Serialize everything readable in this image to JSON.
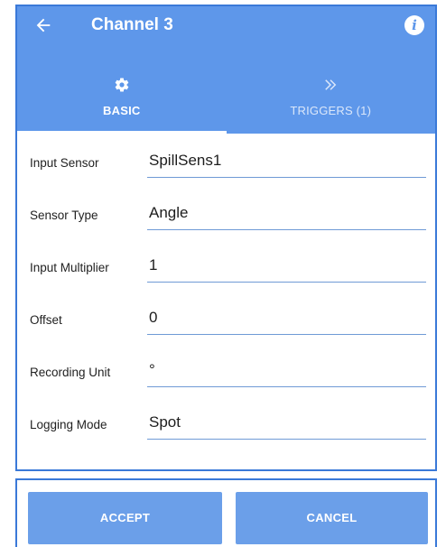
{
  "toolbar": {
    "title": "Channel 3",
    "back_icon": "arrow-left-icon",
    "info_icon": "info-icon",
    "info_glyph": "i"
  },
  "tabs": [
    {
      "label": "BASIC",
      "icon": "gear-icon",
      "active": true
    },
    {
      "label": "TRIGGERS (1)",
      "icon": "double-chevron-right-icon",
      "active": false
    }
  ],
  "form": {
    "rows": [
      {
        "label": "Input Sensor",
        "value": "SpillSens1"
      },
      {
        "label": "Sensor Type",
        "value": "Angle"
      },
      {
        "label": "Input Multiplier",
        "value": "1"
      },
      {
        "label": "Offset",
        "value": "0"
      },
      {
        "label": "Recording Unit",
        "value": "°"
      },
      {
        "label": "Logging Mode",
        "value": "Spot"
      }
    ]
  },
  "actions": {
    "accept_label": "ACCEPT",
    "cancel_label": "CANCEL"
  },
  "colors": {
    "primary": "#5e97ea",
    "button": "#6b9fe9",
    "border": "#3a79d8",
    "underline": "#6f9ad6"
  }
}
